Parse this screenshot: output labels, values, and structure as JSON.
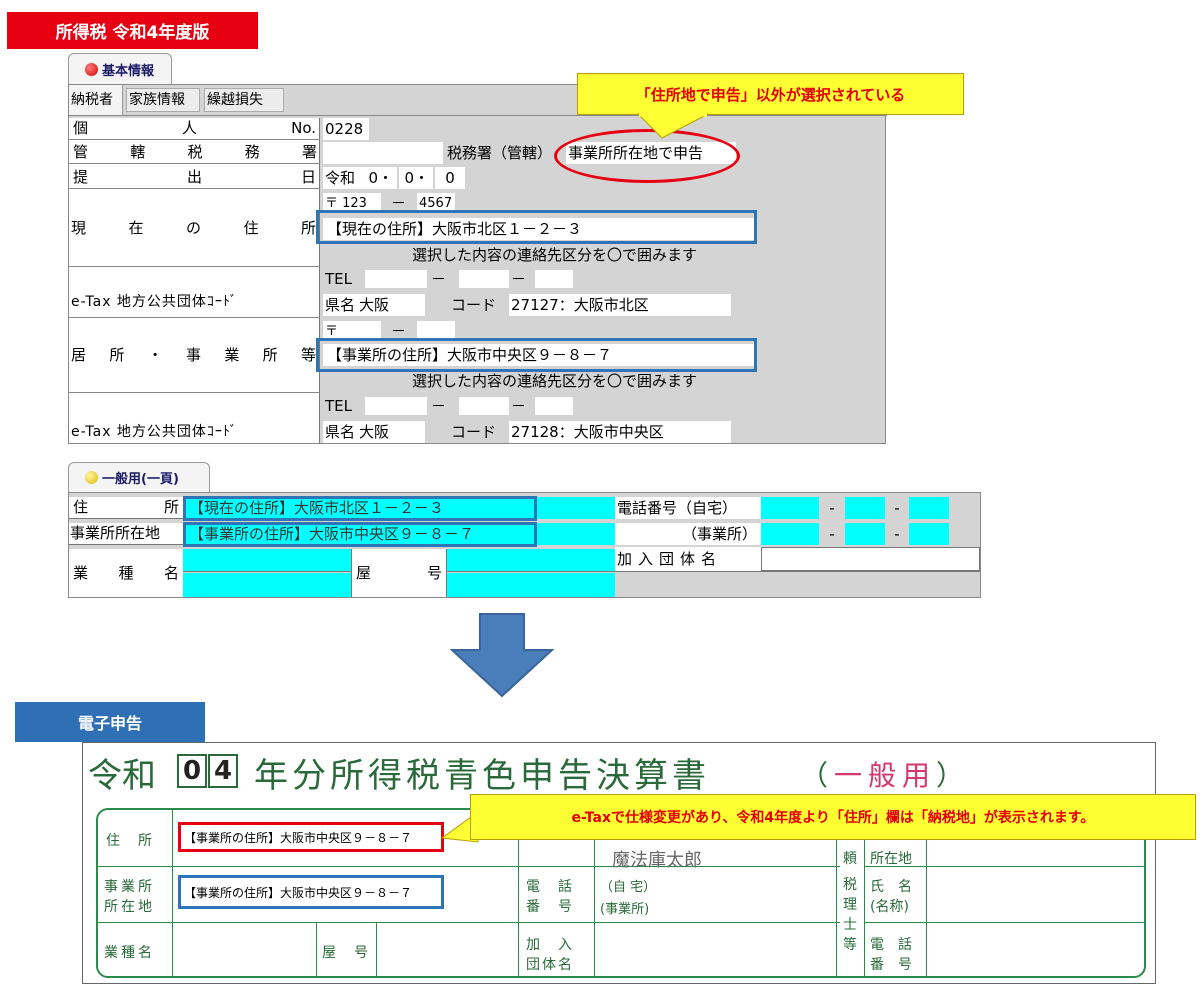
{
  "top_header": {
    "label": "所得税 令和4年度版",
    "color": "#e60012"
  },
  "callouts": {
    "top": "「住所地で申告」以外が選択されている",
    "bottom": "e-Taxで仕様変更があり、令和4年度より「住所」欄は「納税地」が表示されます。"
  },
  "kihon": {
    "tab_label": "基本情報",
    "subtabs": [
      "納税者",
      "家族情報",
      "繰越損失"
    ],
    "rows": {
      "kojin": "個人No.",
      "kojin_value": "0228",
      "kankatsu": "管轄税務署",
      "kankatsu_suffix": "税務署（管轄）",
      "kankatsu_option": "事業所所在地で申告",
      "teishutsu": "提出日",
      "era": "令和",
      "y": "0",
      "m": "0",
      "d": "0",
      "genzai": "現在の住所",
      "postal1a": "〒 123",
      "dash": "－",
      "postal1b": "4567",
      "address1": "【現在の住所】大阪市北区１－２－３",
      "contact_note": "選択した内容の連絡先区分を〇で囲みます",
      "tel": "TEL",
      "etax": "e-Tax 地方公共団体ｺｰﾄﾞ",
      "pref_label": "県名",
      "pref_value": "大阪",
      "code_label": "コード",
      "code1": "27127：大阪市北区",
      "kyosho": "居所・事業所等",
      "postal2a": "〒",
      "address2": "【事業所の住所】大阪市中央区９－８－７",
      "code2": "27128：大阪市中央区"
    }
  },
  "ippan": {
    "tab_label": "一般用(一頁)",
    "jusho": "住所",
    "jusho_value": "【現在の住所】大阪市北区１－２－３",
    "jigyosho": "事業所所在地",
    "jigyosho_value": "【事業所の住所】大阪市中央区９－８－７",
    "gyoshu": "業種名",
    "yago": "屋号",
    "tel_home": "電話番号（自宅）",
    "tel_office": "（事業所）",
    "kanyu": "加入団体名",
    "dash": "-"
  },
  "denshi_header": {
    "label": "電子申告",
    "color": "#2f6fb5"
  },
  "form": {
    "title_pre": "令和",
    "year_digits": [
      "0",
      "4"
    ],
    "title_main": "年分所得税青色申告決算書",
    "title_paren_open": "（",
    "title_paren_text": "一般用",
    "title_paren_close": "）",
    "jusho": "住　所",
    "jusho_value": "【事業所の住所】大阪市中央区９－８－７",
    "jigyosho_line1": "事業所",
    "jigyosho_line2": "所在地",
    "jigyosho_value": "【事業所の住所】大阪市中央区９－８－７",
    "gyoshu": "業種名",
    "yago": "屋　号",
    "name_value": "魔法庫太郎",
    "denwa_line1": "電　話",
    "denwa_line2": "番　号",
    "jitaku": "（自 宅）",
    "jigyosho_paren": "(事業所)",
    "kanyu_line1": "加　入",
    "kanyu_line2": "団体名",
    "irai": "頼",
    "zeiri": "税",
    "ri": "理",
    "shi": "士",
    "to": "等",
    "shozaichi": "所在地",
    "shimei_line1": "氏　名",
    "shimei_line2": "(名称)",
    "denwa2_line1": "電　話",
    "denwa2_line2": "番　号"
  },
  "colors": {
    "cyan": "#00ffff",
    "blue_box": "#2e75b6",
    "red_box": "#e60012",
    "arrow": "#4a7ebb",
    "form_green": "#1f8a43"
  }
}
